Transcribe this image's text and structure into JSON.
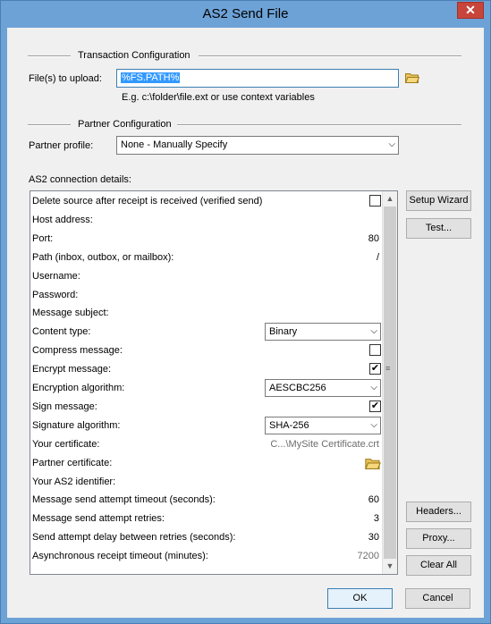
{
  "window": {
    "title": "AS2 Send File",
    "close_label": "✕"
  },
  "transaction": {
    "section_title": "Transaction Configuration",
    "files_label": "File(s) to upload:",
    "files_value": "%FS.PATH%",
    "hint": "E.g. c:\\folder\\file.ext or use context variables",
    "browse_icon": "folder-icon"
  },
  "partner": {
    "section_title": "Partner Configuration",
    "profile_label": "Partner profile:",
    "profile_value": "None - Manually Specify"
  },
  "details": {
    "label": "AS2 connection details:",
    "rows": [
      {
        "name": "Delete source after receipt is received (verified send)",
        "type": "checkbox",
        "checked": false
      },
      {
        "name": "Host address:",
        "type": "text",
        "value": ""
      },
      {
        "name": "Port:",
        "type": "text",
        "value": "80"
      },
      {
        "name": "Path (inbox, outbox, or mailbox):",
        "type": "text",
        "value": "/"
      },
      {
        "name": "Username:",
        "type": "text",
        "value": ""
      },
      {
        "name": "Password:",
        "type": "text",
        "value": ""
      },
      {
        "name": "Message subject:",
        "type": "text",
        "value": ""
      },
      {
        "name": "Content type:",
        "type": "combo",
        "value": "Binary"
      },
      {
        "name": "Compress message:",
        "type": "checkbox",
        "checked": false
      },
      {
        "name": "Encrypt message:",
        "type": "checkbox",
        "checked": true
      },
      {
        "name": "Encryption algorithm:",
        "type": "combo",
        "value": "AESCBC256"
      },
      {
        "name": "Sign message:",
        "type": "checkbox",
        "checked": true
      },
      {
        "name": "Signature algorithm:",
        "type": "combo",
        "value": "SHA-256"
      },
      {
        "name": "Your certificate:",
        "type": "text-grey",
        "value": "C...\\MySite Certificate.crt"
      },
      {
        "name": "Partner certificate:",
        "type": "folder",
        "value": ""
      },
      {
        "name": "Your AS2 identifier:",
        "type": "text",
        "value": ""
      },
      {
        "name": "Message send attempt timeout (seconds):",
        "type": "text",
        "value": "60"
      },
      {
        "name": "Message send attempt retries:",
        "type": "text",
        "value": "3"
      },
      {
        "name": "Send attempt delay between retries (seconds):",
        "type": "text",
        "value": "30"
      },
      {
        "name": "Asynchronous receipt timeout (minutes):",
        "type": "text-grey",
        "value": "7200"
      }
    ]
  },
  "side_buttons": {
    "setup_wizard": "Setup Wizard",
    "test": "Test...",
    "headers": "Headers...",
    "proxy": "Proxy...",
    "clear_all": "Clear All"
  },
  "footer": {
    "ok": "OK",
    "cancel": "Cancel"
  }
}
